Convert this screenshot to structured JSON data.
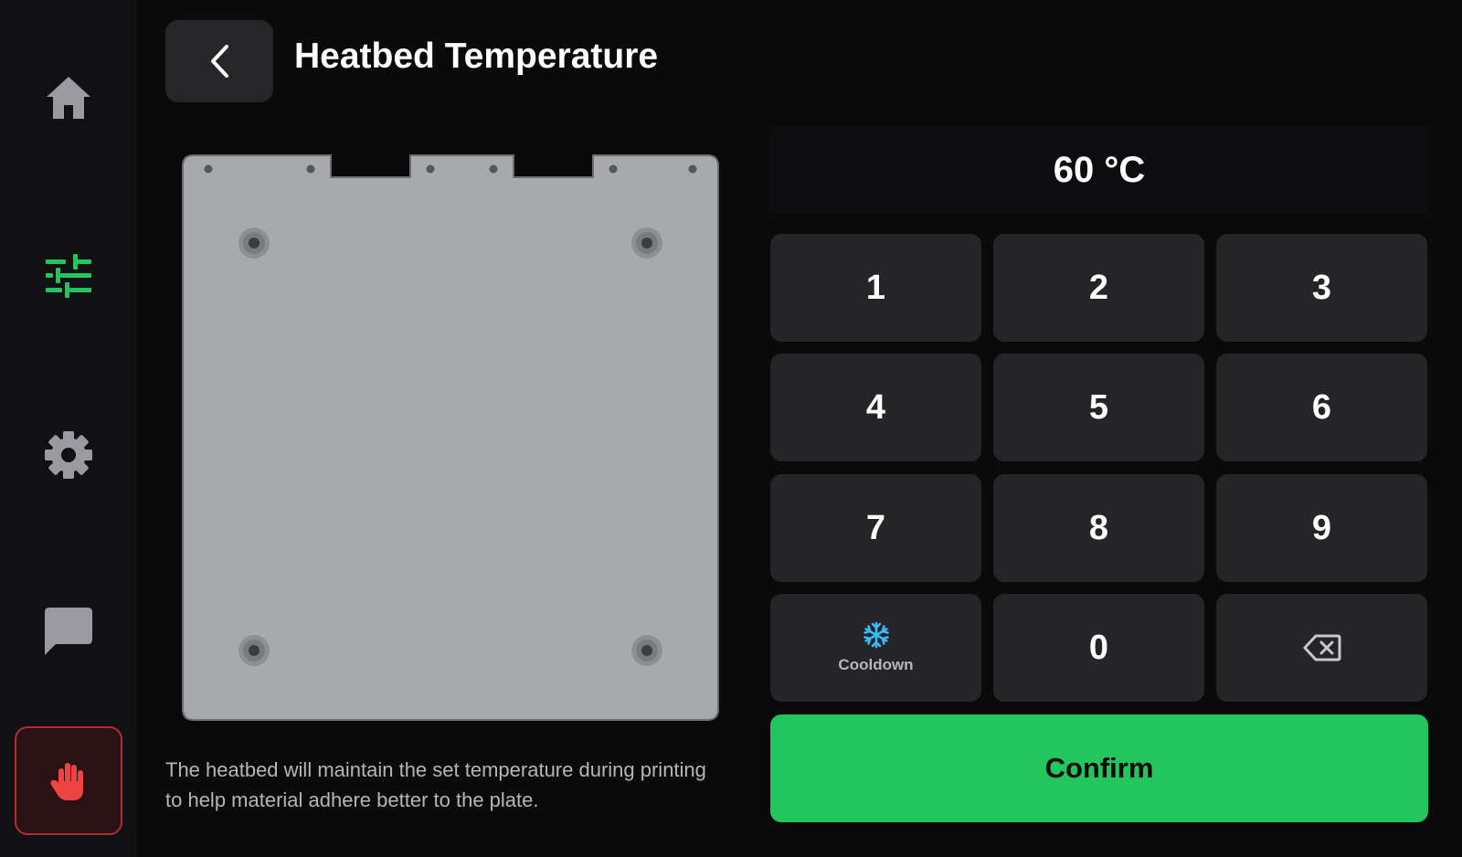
{
  "header": {
    "title": "Heatbed Temperature"
  },
  "sidebar": {
    "items": [
      {
        "icon": "home-icon"
      },
      {
        "icon": "sliders-icon",
        "active": true
      },
      {
        "icon": "gear-icon"
      },
      {
        "icon": "chat-icon"
      }
    ],
    "estop_icon": "hand-stop-icon"
  },
  "description": "The heatbed will maintain the set temperature during printing to help material adhere better to the plate.",
  "temperature": {
    "value": "60 °C"
  },
  "keypad": {
    "keys": [
      "1",
      "2",
      "3",
      "4",
      "5",
      "6",
      "7",
      "8",
      "9",
      "0"
    ],
    "cooldown_label": "Cooldown",
    "cooldown_icon": "snowflake-icon",
    "backspace_icon": "backspace-icon"
  },
  "confirm_label": "Confirm",
  "colors": {
    "accent_green": "#22c55e",
    "estop_red": "#ef4444",
    "snowflake_blue": "#38bdf8",
    "bed_gray": "#a8a9ad"
  }
}
